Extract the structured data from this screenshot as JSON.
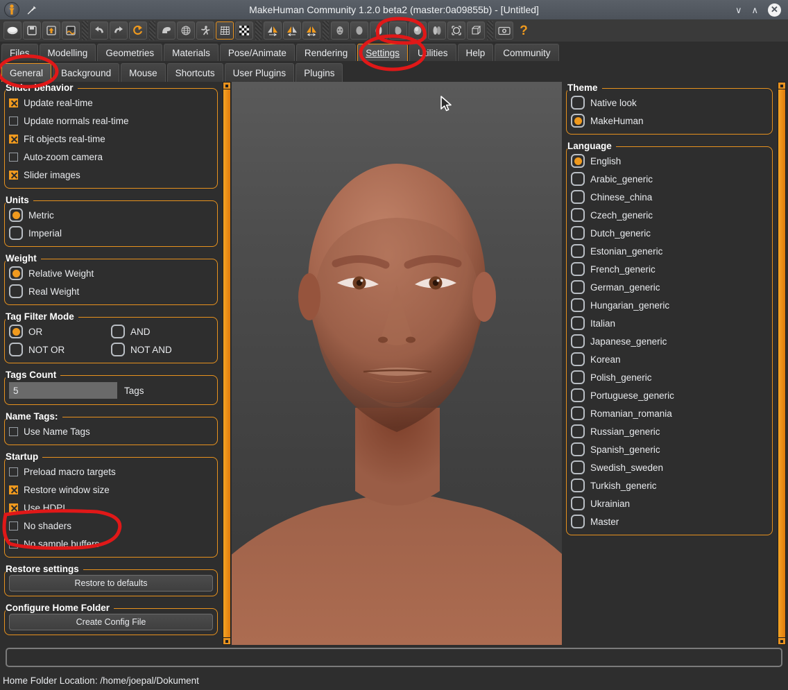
{
  "window": {
    "title": "MakeHuman Community 1.2.0 beta2 (master:0a09855b) - [Untitled]",
    "logo_icon": "makehuman-logo-icon",
    "pin_icon": "pin-icon",
    "minimize_label": "∨",
    "maximize_label": "∧",
    "close_label": "✕"
  },
  "toolbar": {
    "groups": [
      {
        "buttons": [
          {
            "name": "new-icon",
            "active": false
          },
          {
            "name": "save-icon",
            "active": false
          },
          {
            "name": "load-icon",
            "active": false
          },
          {
            "name": "export-icon",
            "active": false
          }
        ]
      },
      {
        "buttons": [
          {
            "name": "undo-icon",
            "active": false
          },
          {
            "name": "redo-icon",
            "active": false
          },
          {
            "name": "reset-mesh-icon",
            "active": false
          }
        ]
      },
      {
        "buttons": [
          {
            "name": "smooth-icon",
            "active": false
          },
          {
            "name": "wireframe-globe-icon",
            "active": false
          },
          {
            "name": "pose-skeleton-icon",
            "active": false
          },
          {
            "name": "grid-icon",
            "active": true
          },
          {
            "name": "subdivision-checker-icon",
            "active": false
          }
        ]
      },
      {
        "buttons": [
          {
            "name": "symmetry-right-icon",
            "active": false
          },
          {
            "name": "symmetry-left-icon",
            "active": false
          },
          {
            "name": "symmetry-both-icon",
            "active": false
          }
        ]
      },
      {
        "buttons": [
          {
            "name": "front-view-icon",
            "active": false
          },
          {
            "name": "back-view-icon",
            "active": false
          },
          {
            "name": "left-view-icon",
            "active": false
          },
          {
            "name": "right-view-icon",
            "active": false
          },
          {
            "name": "top-view-icon",
            "active": false
          },
          {
            "name": "bottom-view-icon",
            "active": false
          },
          {
            "name": "reset-camera-icon",
            "active": false
          },
          {
            "name": "orthogonal-view-icon",
            "active": false
          }
        ]
      },
      {
        "buttons": [
          {
            "name": "grab-screen-icon",
            "active": false
          },
          {
            "name": "help-icon",
            "active": false
          }
        ]
      }
    ]
  },
  "main_tabs": {
    "active": "Settings",
    "items": [
      "Files",
      "Modelling",
      "Geometries",
      "Materials",
      "Pose/Animate",
      "Rendering",
      "Settings",
      "Utilities",
      "Help",
      "Community"
    ]
  },
  "sub_tabs": {
    "active": "General",
    "items": [
      "General",
      "Background",
      "Mouse",
      "Shortcuts",
      "User Plugins",
      "Plugins"
    ]
  },
  "left_panel": {
    "slider_behavior": {
      "title": "Slider behavior",
      "options": [
        {
          "label": "Update real-time",
          "checked": true
        },
        {
          "label": "Update normals real-time",
          "checked": false
        },
        {
          "label": "Fit objects real-time",
          "checked": true
        },
        {
          "label": "Auto-zoom camera",
          "checked": false
        },
        {
          "label": "Slider images",
          "checked": true
        }
      ]
    },
    "units": {
      "title": "Units",
      "options": [
        {
          "label": "Metric",
          "selected": true
        },
        {
          "label": "Imperial",
          "selected": false
        }
      ]
    },
    "weight": {
      "title": "Weight",
      "options": [
        {
          "label": "Relative Weight",
          "selected": true
        },
        {
          "label": "Real Weight",
          "selected": false
        }
      ]
    },
    "tag_filter_mode": {
      "title": "Tag Filter Mode",
      "options": [
        {
          "label": "OR",
          "selected": true
        },
        {
          "label": "AND",
          "selected": false
        },
        {
          "label": "NOT OR",
          "selected": false
        },
        {
          "label": "NOT AND",
          "selected": false
        }
      ]
    },
    "tags_count": {
      "title": "Tags Count",
      "value": "5",
      "unit_label": "Tags"
    },
    "name_tags": {
      "title": "Name Tags:",
      "options": [
        {
          "label": "Use Name Tags",
          "checked": false
        }
      ]
    },
    "startup": {
      "title": "Startup",
      "options": [
        {
          "label": "Preload macro targets",
          "checked": false
        },
        {
          "label": "Restore window size",
          "checked": true
        },
        {
          "label": "Use HDPI",
          "checked": true
        },
        {
          "label": "No shaders",
          "checked": false
        },
        {
          "label": "No sample buffers",
          "checked": false
        }
      ]
    },
    "restore_settings": {
      "title": "Restore settings",
      "button_label": "Restore to defaults"
    },
    "configure_home_folder": {
      "title": "Configure Home Folder",
      "button_label": "Create Config File"
    }
  },
  "right_panel": {
    "theme": {
      "title": "Theme",
      "options": [
        {
          "label": "Native look",
          "selected": false
        },
        {
          "label": "MakeHuman",
          "selected": true
        }
      ]
    },
    "language": {
      "title": "Language",
      "options": [
        {
          "label": "English",
          "selected": true
        },
        {
          "label": "Arabic_generic",
          "selected": false
        },
        {
          "label": "Chinese_china",
          "selected": false
        },
        {
          "label": "Czech_generic",
          "selected": false
        },
        {
          "label": "Dutch_generic",
          "selected": false
        },
        {
          "label": "Estonian_generic",
          "selected": false
        },
        {
          "label": "French_generic",
          "selected": false
        },
        {
          "label": "German_generic",
          "selected": false
        },
        {
          "label": "Hungarian_generic",
          "selected": false
        },
        {
          "label": "Italian",
          "selected": false
        },
        {
          "label": "Japanese_generic",
          "selected": false
        },
        {
          "label": "Korean",
          "selected": false
        },
        {
          "label": "Polish_generic",
          "selected": false
        },
        {
          "label": "Portuguese_generic",
          "selected": false
        },
        {
          "label": "Romanian_romania",
          "selected": false
        },
        {
          "label": "Russian_generic",
          "selected": false
        },
        {
          "label": "Spanish_generic",
          "selected": false
        },
        {
          "label": "Swedish_sweden",
          "selected": false
        },
        {
          "label": "Turkish_generic",
          "selected": false
        },
        {
          "label": "Ukrainian",
          "selected": false
        },
        {
          "label": "Master",
          "selected": false
        }
      ]
    }
  },
  "viewport": {
    "model": "human-head-3d-model",
    "cursor": "mouse-pointer"
  },
  "statusbar": {
    "text": "Home Folder Location: /home/joepal/Dokument"
  },
  "annotations": {
    "color": "#e01818",
    "marks": [
      "settings-tab-circle",
      "general-tab-circle",
      "toolbar-icons-circle",
      "no-shaders-circle"
    ]
  },
  "colors": {
    "accent": "#e8921e",
    "panel_bg": "#2e2e2e",
    "text": "#e9ebee",
    "skin": "#a5664e"
  }
}
